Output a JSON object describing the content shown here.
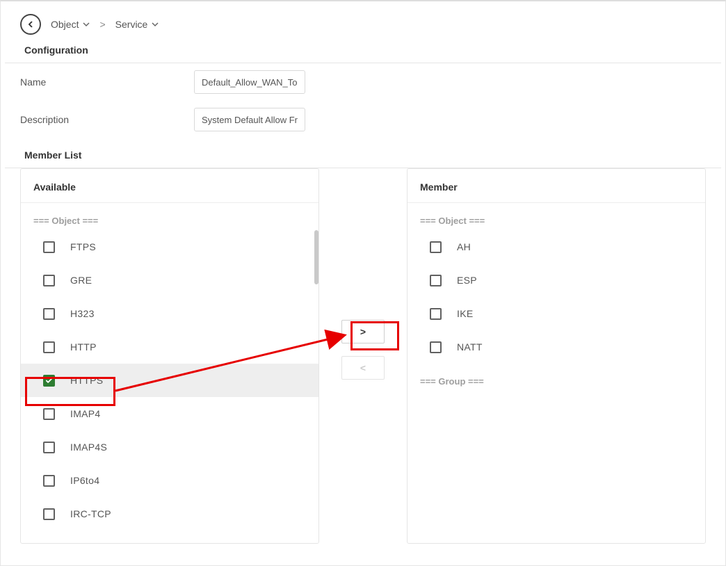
{
  "breadcrumb": {
    "object": "Object",
    "sep": ">",
    "service": "Service"
  },
  "sections": {
    "configuration": "Configuration",
    "member_list": "Member List"
  },
  "form": {
    "name_label": "Name",
    "name_value": "Default_Allow_WAN_To",
    "desc_label": "Description",
    "desc_value": "System Default Allow Fr"
  },
  "available": {
    "title": "Available",
    "group_label": "=== Object ===",
    "items": [
      {
        "label": "FTPS",
        "checked": false
      },
      {
        "label": "GRE",
        "checked": false
      },
      {
        "label": "H323",
        "checked": false
      },
      {
        "label": "HTTP",
        "checked": false
      },
      {
        "label": "HTTPS",
        "checked": true
      },
      {
        "label": "IMAP4",
        "checked": false
      },
      {
        "label": "IMAP4S",
        "checked": false
      },
      {
        "label": "IP6to4",
        "checked": false
      },
      {
        "label": "IRC-TCP",
        "checked": false
      }
    ]
  },
  "member": {
    "title": "Member",
    "group_label": "=== Object ===",
    "items": [
      {
        "label": "AH",
        "checked": false
      },
      {
        "label": "ESP",
        "checked": false
      },
      {
        "label": "IKE",
        "checked": false
      },
      {
        "label": "NATT",
        "checked": false
      }
    ],
    "group_label2": "=== Group ==="
  },
  "transfer": {
    "add": ">",
    "remove": "<"
  },
  "annotation": {
    "highlight_item": "HTTPS",
    "arrow_color": "#e60000"
  }
}
